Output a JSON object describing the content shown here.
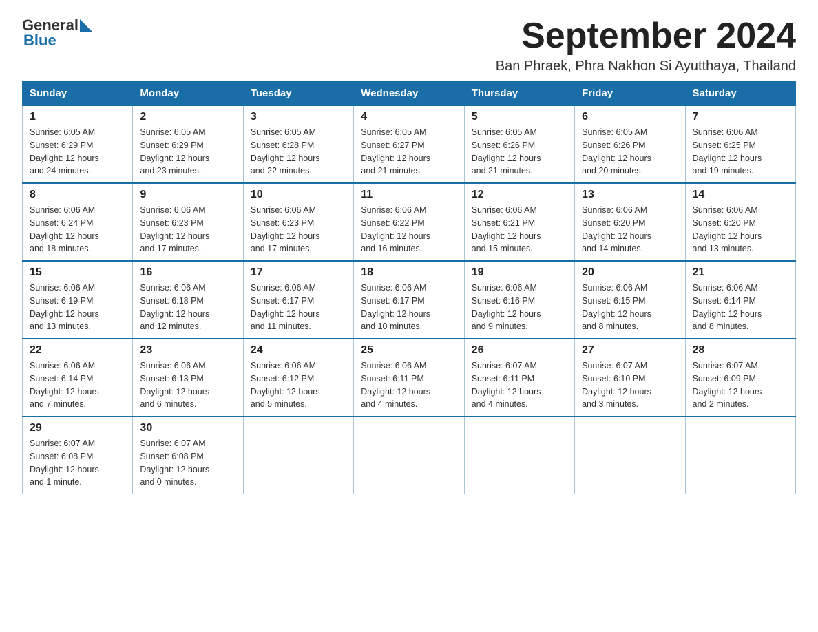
{
  "header": {
    "logo_general": "General",
    "logo_blue": "Blue",
    "month_title": "September 2024",
    "subtitle": "Ban Phraek, Phra Nakhon Si Ayutthaya, Thailand"
  },
  "days_of_week": [
    "Sunday",
    "Monday",
    "Tuesday",
    "Wednesday",
    "Thursday",
    "Friday",
    "Saturday"
  ],
  "weeks": [
    [
      {
        "num": "1",
        "sunrise": "6:05 AM",
        "sunset": "6:29 PM",
        "daylight": "12 hours and 24 minutes."
      },
      {
        "num": "2",
        "sunrise": "6:05 AM",
        "sunset": "6:29 PM",
        "daylight": "12 hours and 23 minutes."
      },
      {
        "num": "3",
        "sunrise": "6:05 AM",
        "sunset": "6:28 PM",
        "daylight": "12 hours and 22 minutes."
      },
      {
        "num": "4",
        "sunrise": "6:05 AM",
        "sunset": "6:27 PM",
        "daylight": "12 hours and 21 minutes."
      },
      {
        "num": "5",
        "sunrise": "6:05 AM",
        "sunset": "6:26 PM",
        "daylight": "12 hours and 21 minutes."
      },
      {
        "num": "6",
        "sunrise": "6:05 AM",
        "sunset": "6:26 PM",
        "daylight": "12 hours and 20 minutes."
      },
      {
        "num": "7",
        "sunrise": "6:06 AM",
        "sunset": "6:25 PM",
        "daylight": "12 hours and 19 minutes."
      }
    ],
    [
      {
        "num": "8",
        "sunrise": "6:06 AM",
        "sunset": "6:24 PM",
        "daylight": "12 hours and 18 minutes."
      },
      {
        "num": "9",
        "sunrise": "6:06 AM",
        "sunset": "6:23 PM",
        "daylight": "12 hours and 17 minutes."
      },
      {
        "num": "10",
        "sunrise": "6:06 AM",
        "sunset": "6:23 PM",
        "daylight": "12 hours and 17 minutes."
      },
      {
        "num": "11",
        "sunrise": "6:06 AM",
        "sunset": "6:22 PM",
        "daylight": "12 hours and 16 minutes."
      },
      {
        "num": "12",
        "sunrise": "6:06 AM",
        "sunset": "6:21 PM",
        "daylight": "12 hours and 15 minutes."
      },
      {
        "num": "13",
        "sunrise": "6:06 AM",
        "sunset": "6:20 PM",
        "daylight": "12 hours and 14 minutes."
      },
      {
        "num": "14",
        "sunrise": "6:06 AM",
        "sunset": "6:20 PM",
        "daylight": "12 hours and 13 minutes."
      }
    ],
    [
      {
        "num": "15",
        "sunrise": "6:06 AM",
        "sunset": "6:19 PM",
        "daylight": "12 hours and 13 minutes."
      },
      {
        "num": "16",
        "sunrise": "6:06 AM",
        "sunset": "6:18 PM",
        "daylight": "12 hours and 12 minutes."
      },
      {
        "num": "17",
        "sunrise": "6:06 AM",
        "sunset": "6:17 PM",
        "daylight": "12 hours and 11 minutes."
      },
      {
        "num": "18",
        "sunrise": "6:06 AM",
        "sunset": "6:17 PM",
        "daylight": "12 hours and 10 minutes."
      },
      {
        "num": "19",
        "sunrise": "6:06 AM",
        "sunset": "6:16 PM",
        "daylight": "12 hours and 9 minutes."
      },
      {
        "num": "20",
        "sunrise": "6:06 AM",
        "sunset": "6:15 PM",
        "daylight": "12 hours and 8 minutes."
      },
      {
        "num": "21",
        "sunrise": "6:06 AM",
        "sunset": "6:14 PM",
        "daylight": "12 hours and 8 minutes."
      }
    ],
    [
      {
        "num": "22",
        "sunrise": "6:06 AM",
        "sunset": "6:14 PM",
        "daylight": "12 hours and 7 minutes."
      },
      {
        "num": "23",
        "sunrise": "6:06 AM",
        "sunset": "6:13 PM",
        "daylight": "12 hours and 6 minutes."
      },
      {
        "num": "24",
        "sunrise": "6:06 AM",
        "sunset": "6:12 PM",
        "daylight": "12 hours and 5 minutes."
      },
      {
        "num": "25",
        "sunrise": "6:06 AM",
        "sunset": "6:11 PM",
        "daylight": "12 hours and 4 minutes."
      },
      {
        "num": "26",
        "sunrise": "6:07 AM",
        "sunset": "6:11 PM",
        "daylight": "12 hours and 4 minutes."
      },
      {
        "num": "27",
        "sunrise": "6:07 AM",
        "sunset": "6:10 PM",
        "daylight": "12 hours and 3 minutes."
      },
      {
        "num": "28",
        "sunrise": "6:07 AM",
        "sunset": "6:09 PM",
        "daylight": "12 hours and 2 minutes."
      }
    ],
    [
      {
        "num": "29",
        "sunrise": "6:07 AM",
        "sunset": "6:08 PM",
        "daylight": "12 hours and 1 minute."
      },
      {
        "num": "30",
        "sunrise": "6:07 AM",
        "sunset": "6:08 PM",
        "daylight": "12 hours and 0 minutes."
      },
      null,
      null,
      null,
      null,
      null
    ]
  ],
  "labels": {
    "sunrise": "Sunrise:",
    "sunset": "Sunset:",
    "daylight": "Daylight:"
  }
}
